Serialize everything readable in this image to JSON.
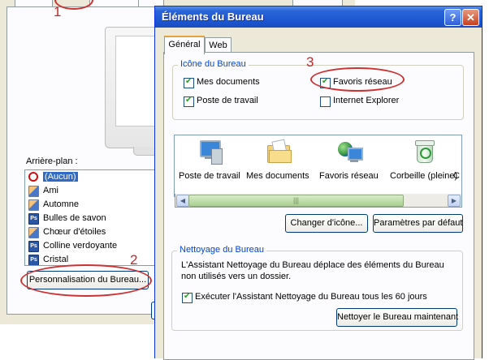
{
  "background_window": {
    "wallpaper_label": "Arrière-plan :",
    "wallpaper_items": [
      {
        "label": "(Aucun)",
        "icon": "no-entry-icon",
        "selected": true
      },
      {
        "label": "Ami",
        "icon": "image-file-icon"
      },
      {
        "label": "Automne",
        "icon": "image-file-icon"
      },
      {
        "label": "Bulles de savon",
        "icon": "photoshop-file-icon"
      },
      {
        "label": "Chœur d'étoiles",
        "icon": "image-file-icon"
      },
      {
        "label": "Colline verdoyante",
        "icon": "photoshop-file-icon"
      },
      {
        "label": "Cristal",
        "icon": "photoshop-file-icon"
      }
    ],
    "customize_button": "Personnalisation du Bureau...",
    "ps_glyph": "Ps"
  },
  "annotations": {
    "n1": "1",
    "n2": "2",
    "n3": "3",
    "color": "#c42828"
  },
  "dialog": {
    "title": "Éléments du Bureau",
    "help_glyph": "?",
    "close_glyph": "✕",
    "tabs": {
      "general": "Général",
      "web": "Web"
    },
    "icon_group": {
      "title": "Icône du Bureau",
      "mes_documents": "Mes documents",
      "favoris_reseau": "Favoris réseau",
      "poste_de_travail": "Poste de travail",
      "internet_explorer": "Internet Explorer",
      "checked": {
        "mes_documents": true,
        "favoris_reseau": true,
        "poste_de_travail": true,
        "internet_explorer": false
      }
    },
    "icon_list": [
      {
        "label": "Poste de travail",
        "icon": "computer-icon"
      },
      {
        "label": "Mes documents",
        "icon": "folder-documents-icon"
      },
      {
        "label": "Favoris réseau",
        "icon": "network-globe-icon"
      },
      {
        "label": "Corbeille (pleine)",
        "icon": "recycle-bin-icon"
      },
      {
        "label": "C",
        "icon": "partial-icon"
      }
    ],
    "scroll": {
      "left": "◀",
      "right": "▶",
      "grip": "|||"
    },
    "change_icon_button": "Changer d'icône...",
    "default_params_button": "Paramètres par défaut",
    "cleanup": {
      "title": "Nettoyage du Bureau",
      "description": "L'Assistant Nettoyage du Bureau déplace des éléments du Bureau non utilisés vers un dossier.",
      "run_every_label": "Exécuter l'Assistant Nettoyage du Bureau tous les 60 jours",
      "run_every_checked": true,
      "clean_now_button": "Nettoyer le Bureau maintenant"
    }
  },
  "colors": {
    "xp_title_blue": "#1b56d0",
    "dialog_face": "#ece9d8",
    "group_title_blue": "#0046d5",
    "selection_blue": "#316ac5"
  }
}
